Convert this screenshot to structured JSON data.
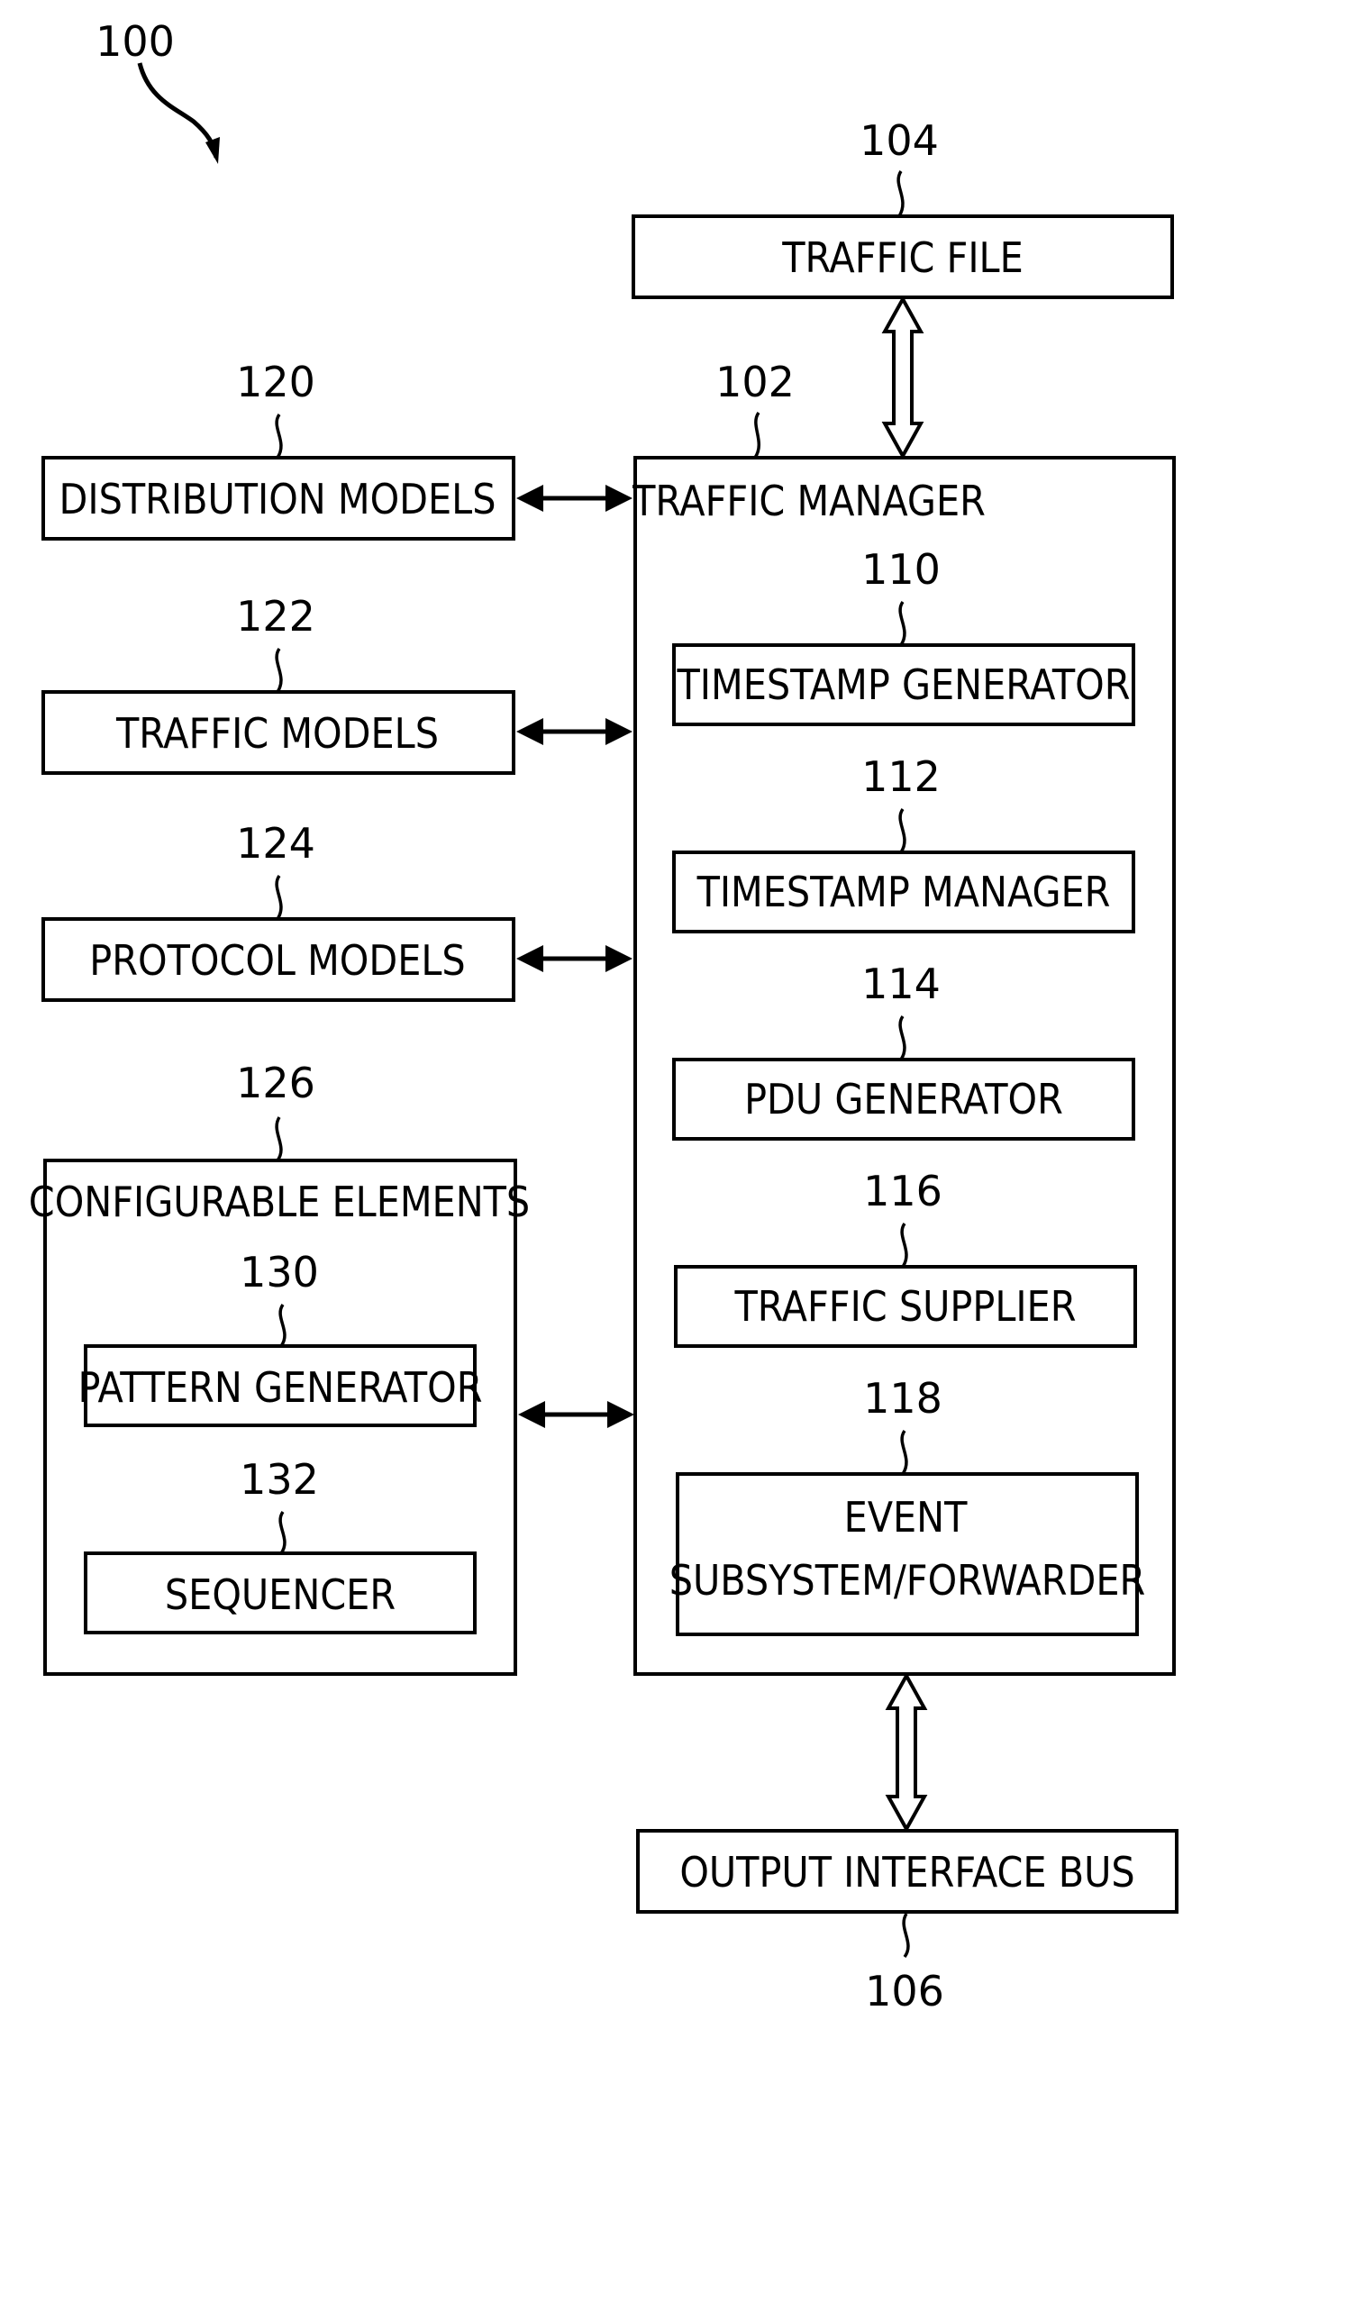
{
  "figure": {
    "ref": "100",
    "traffic_file": {
      "ref": "104",
      "label": "TRAFFIC FILE"
    },
    "traffic_manager": {
      "ref": "102",
      "label": "TRAFFIC MANAGER",
      "components": [
        {
          "ref": "110",
          "label": "TIMESTAMP GENERATOR"
        },
        {
          "ref": "112",
          "label": "TIMESTAMP MANAGER"
        },
        {
          "ref": "114",
          "label": "PDU GENERATOR"
        },
        {
          "ref": "116",
          "label": "TRAFFIC SUPPLIER"
        },
        {
          "ref": "118",
          "label_line1": "EVENT",
          "label_line2": "SUBSYSTEM/FORWARDER"
        }
      ]
    },
    "models": [
      {
        "ref": "120",
        "label": "DISTRIBUTION MODELS"
      },
      {
        "ref": "122",
        "label": "TRAFFIC MODELS"
      },
      {
        "ref": "124",
        "label": "PROTOCOL MODELS"
      }
    ],
    "configurable_elements": {
      "ref": "126",
      "label": "CONFIGURABLE ELEMENTS",
      "components": [
        {
          "ref": "130",
          "label": "PATTERN GENERATOR"
        },
        {
          "ref": "132",
          "label": "SEQUENCER"
        }
      ]
    },
    "output_bus": {
      "ref": "106",
      "label": "OUTPUT INTERFACE BUS"
    }
  }
}
